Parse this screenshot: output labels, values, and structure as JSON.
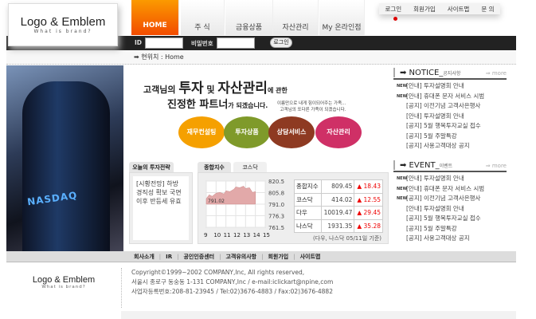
{
  "brand": {
    "title": "Logo & Emblem",
    "tagline": "What is brand?"
  },
  "nav": [
    {
      "label": "HOME",
      "active": true
    },
    {
      "label": "주 식"
    },
    {
      "label": "금융상품"
    },
    {
      "label": "자산관리"
    },
    {
      "label": "My 온라인점"
    }
  ],
  "toplinks": [
    "로그인",
    "회원가입",
    "사이트맵",
    "문 의"
  ],
  "login": {
    "id_label": "ID",
    "pw_label": "비밀번호",
    "button": "로그인"
  },
  "breadcrumb": "➡ 현위치 : Home",
  "photo": {
    "sign": "NASDAQ"
  },
  "hero": {
    "l1a": "고객님의 ",
    "l1b": "투자",
    "l1c": " 및 ",
    "l1d": "자산관리",
    "l1e": "에 관한",
    "l2a": "진정한 파트너",
    "l2b": "가 되겠습니다.",
    "small1": "이름만으로 내게 힘이되어주는 가족...",
    "small2": "고객님의 또다른 가족이 되겠습니다."
  },
  "services": [
    {
      "label": "재무컨설팅",
      "color": "#f5a000"
    },
    {
      "label": "투자상품",
      "color": "#7f9a2a"
    },
    {
      "label": "상담서비스",
      "color": "#8e3a22"
    },
    {
      "label": "자산관리",
      "color": "#cf3066"
    }
  ],
  "strategy": {
    "tab": "오늘의 투자전략",
    "text": "[시황전망] 하방 경직성 확보 국면 이후 반등세 유효"
  },
  "index_tabs": [
    "종합지수",
    "코스닥"
  ],
  "chart_data": {
    "type": "area",
    "x_ticks": [
      "9",
      "10",
      "11",
      "12",
      "13",
      "14",
      "15"
    ],
    "y_ticks": [
      "820.5",
      "805.8",
      "791.0",
      "776.3",
      "761.5"
    ],
    "ylim": [
      761.5,
      820.5
    ],
    "xlim": [
      9,
      15
    ],
    "baseline_label": "791.02",
    "x": [
      9,
      9.3,
      9.6,
      10,
      10.4,
      10.8,
      11,
      11.4,
      11.8,
      12,
      12.4,
      12.8,
      13,
      13.4,
      13.7,
      14
    ],
    "y": [
      798,
      803,
      801,
      805,
      806,
      804,
      808,
      807,
      810,
      813,
      812,
      814,
      811,
      812,
      806,
      807
    ],
    "color": "#e2a9a9"
  },
  "indices": [
    {
      "name": "종합지수",
      "value": "809.45",
      "change": "▲ 18.43"
    },
    {
      "name": "코스닥",
      "value": "414.02",
      "change": "▲ 12.55"
    },
    {
      "name": "다우",
      "value": "10019.47",
      "change": "▲ 29.45"
    },
    {
      "name": "나스닥",
      "value": "1931.35",
      "change": "▲ 35.28"
    }
  ],
  "index_note": "(다우, 나스닥 05/11일 기준)",
  "notice": {
    "title": "➡ NOTICE_",
    "sub": "공지사항",
    "more": "⇒ more",
    "items": [
      {
        "new": true,
        "text": "[안내] 투자설명회 안내"
      },
      {
        "new": true,
        "text": "[안내] 휴대폰 문자 서비스 시범"
      },
      {
        "text": "[공지] 이전기념 고객사은행사"
      },
      {
        "text": "[안내] 투자설명회 안내"
      },
      {
        "text": "[공지] 5월 행복투자교실 접수"
      },
      {
        "text": "[공지] 5월 주말특강"
      },
      {
        "text": "[공지] 사용고객대상 공지"
      }
    ]
  },
  "event": {
    "title": "➡ EVENT_",
    "sub": "이벤트",
    "more": "⇒ more",
    "items": [
      {
        "new": true,
        "text": "[안내] 투자설명회 안내"
      },
      {
        "new": true,
        "text": "[안내] 휴대폰 문자 서비스 시범"
      },
      {
        "new": true,
        "text": "[공지] 이전기념 고객사은행사"
      },
      {
        "text": "[안내] 투자설명회 안내"
      },
      {
        "text": "[공지] 5월 행복투자교실 접수"
      },
      {
        "text": "[공지] 5월 주말특강"
      },
      {
        "text": "[공지] 사용고객대상 공지"
      }
    ]
  },
  "new_badge": "NEW",
  "footer_nav": [
    "회사소개",
    "IR",
    "공인인증센터",
    "고객유의사항",
    "회원가입",
    "사이트맵"
  ],
  "footer_lines": [
    "Copyright©1999~2002 COMPANY,Inc, All rights reserved,",
    "서울시 종로구 동숭동 1-131 COMPANY,Inc / e-mail:iclickart@npine,com",
    "사업자등록번호:208-81-23945  / Tel:02)3676-4883 / Fax:02)3676-4882"
  ]
}
